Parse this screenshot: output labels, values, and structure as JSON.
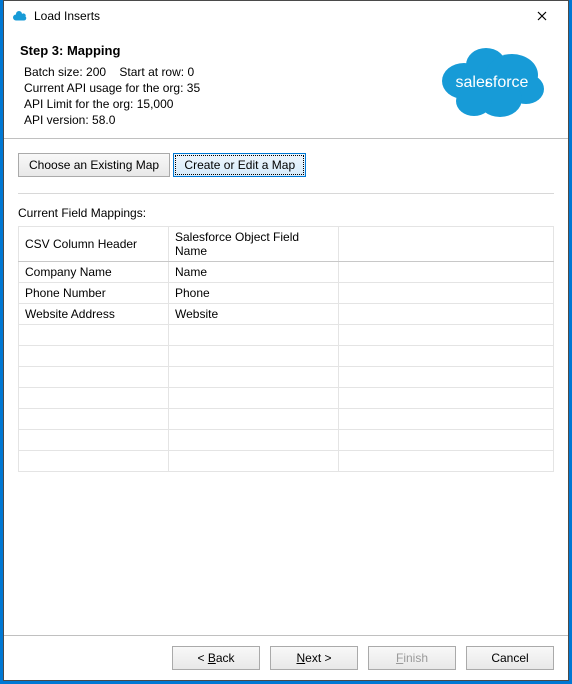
{
  "window": {
    "title": "Load Inserts"
  },
  "header": {
    "step_title": "Step 3: Mapping",
    "batch_label": "Batch size:",
    "batch_value": "200",
    "start_label": "Start at row:",
    "start_value": "0",
    "api_usage_label": "Current API usage for the org:",
    "api_usage_value": "35",
    "api_limit_label": "API Limit for the org:",
    "api_limit_value": "15,000",
    "api_version_label": "API version:",
    "api_version_value": "58.0"
  },
  "logo": {
    "text": "salesforce"
  },
  "buttons": {
    "choose_map": "Choose an Existing Map",
    "create_map": "Create or Edit a Map"
  },
  "mappings": {
    "section_label": "Current Field Mappings:",
    "columns": {
      "csv": "CSV Column Header",
      "sf": "Salesforce Object Field Name",
      "extra": ""
    },
    "rows": [
      {
        "csv": "Company Name",
        "sf": "Name"
      },
      {
        "csv": "Phone Number",
        "sf": "Phone"
      },
      {
        "csv": "Website Address",
        "sf": "Website"
      },
      {
        "csv": "",
        "sf": ""
      },
      {
        "csv": "",
        "sf": ""
      },
      {
        "csv": "",
        "sf": ""
      },
      {
        "csv": "",
        "sf": ""
      },
      {
        "csv": "",
        "sf": ""
      },
      {
        "csv": "",
        "sf": ""
      },
      {
        "csv": "",
        "sf": ""
      }
    ]
  },
  "footer": {
    "back_pre": "< ",
    "back_mn": "B",
    "back_post": "ack",
    "next_mn": "N",
    "next_post": "ext >",
    "finish_mn": "F",
    "finish_post": "inish",
    "cancel": "Cancel"
  }
}
